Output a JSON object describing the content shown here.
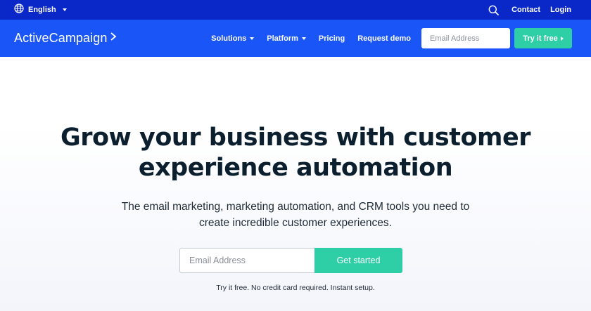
{
  "topbar": {
    "language_label": "English",
    "contact_label": "Contact",
    "login_label": "Login",
    "icons": {
      "language": "globe-icon",
      "search": "search-icon"
    }
  },
  "nav": {
    "logo_text": "ActiveCampaign",
    "logo_icon": "chevron-right-icon",
    "items": [
      {
        "label": "Solutions",
        "has_dropdown": true
      },
      {
        "label": "Platform",
        "has_dropdown": true
      },
      {
        "label": "Pricing",
        "has_dropdown": false
      },
      {
        "label": "Request demo",
        "has_dropdown": false
      }
    ],
    "email_placeholder": "Email Address",
    "try_label": "Try it free"
  },
  "hero": {
    "title_line1": "Grow your business with customer",
    "title_line2": "experience automation",
    "subtitle_line1": "The email marketing, marketing automation, and CRM tools you need to",
    "subtitle_line2": "create incredible customer experiences.",
    "email_placeholder": "Email Address",
    "cta_label": "Get started",
    "fine_print": "Try it free. No credit card required. Instant setup."
  },
  "colors": {
    "topbar_bg": "#0a27c8",
    "nav_bg": "#1a55f7",
    "accent": "#2ecfa7",
    "heading": "#0b1f2e"
  }
}
